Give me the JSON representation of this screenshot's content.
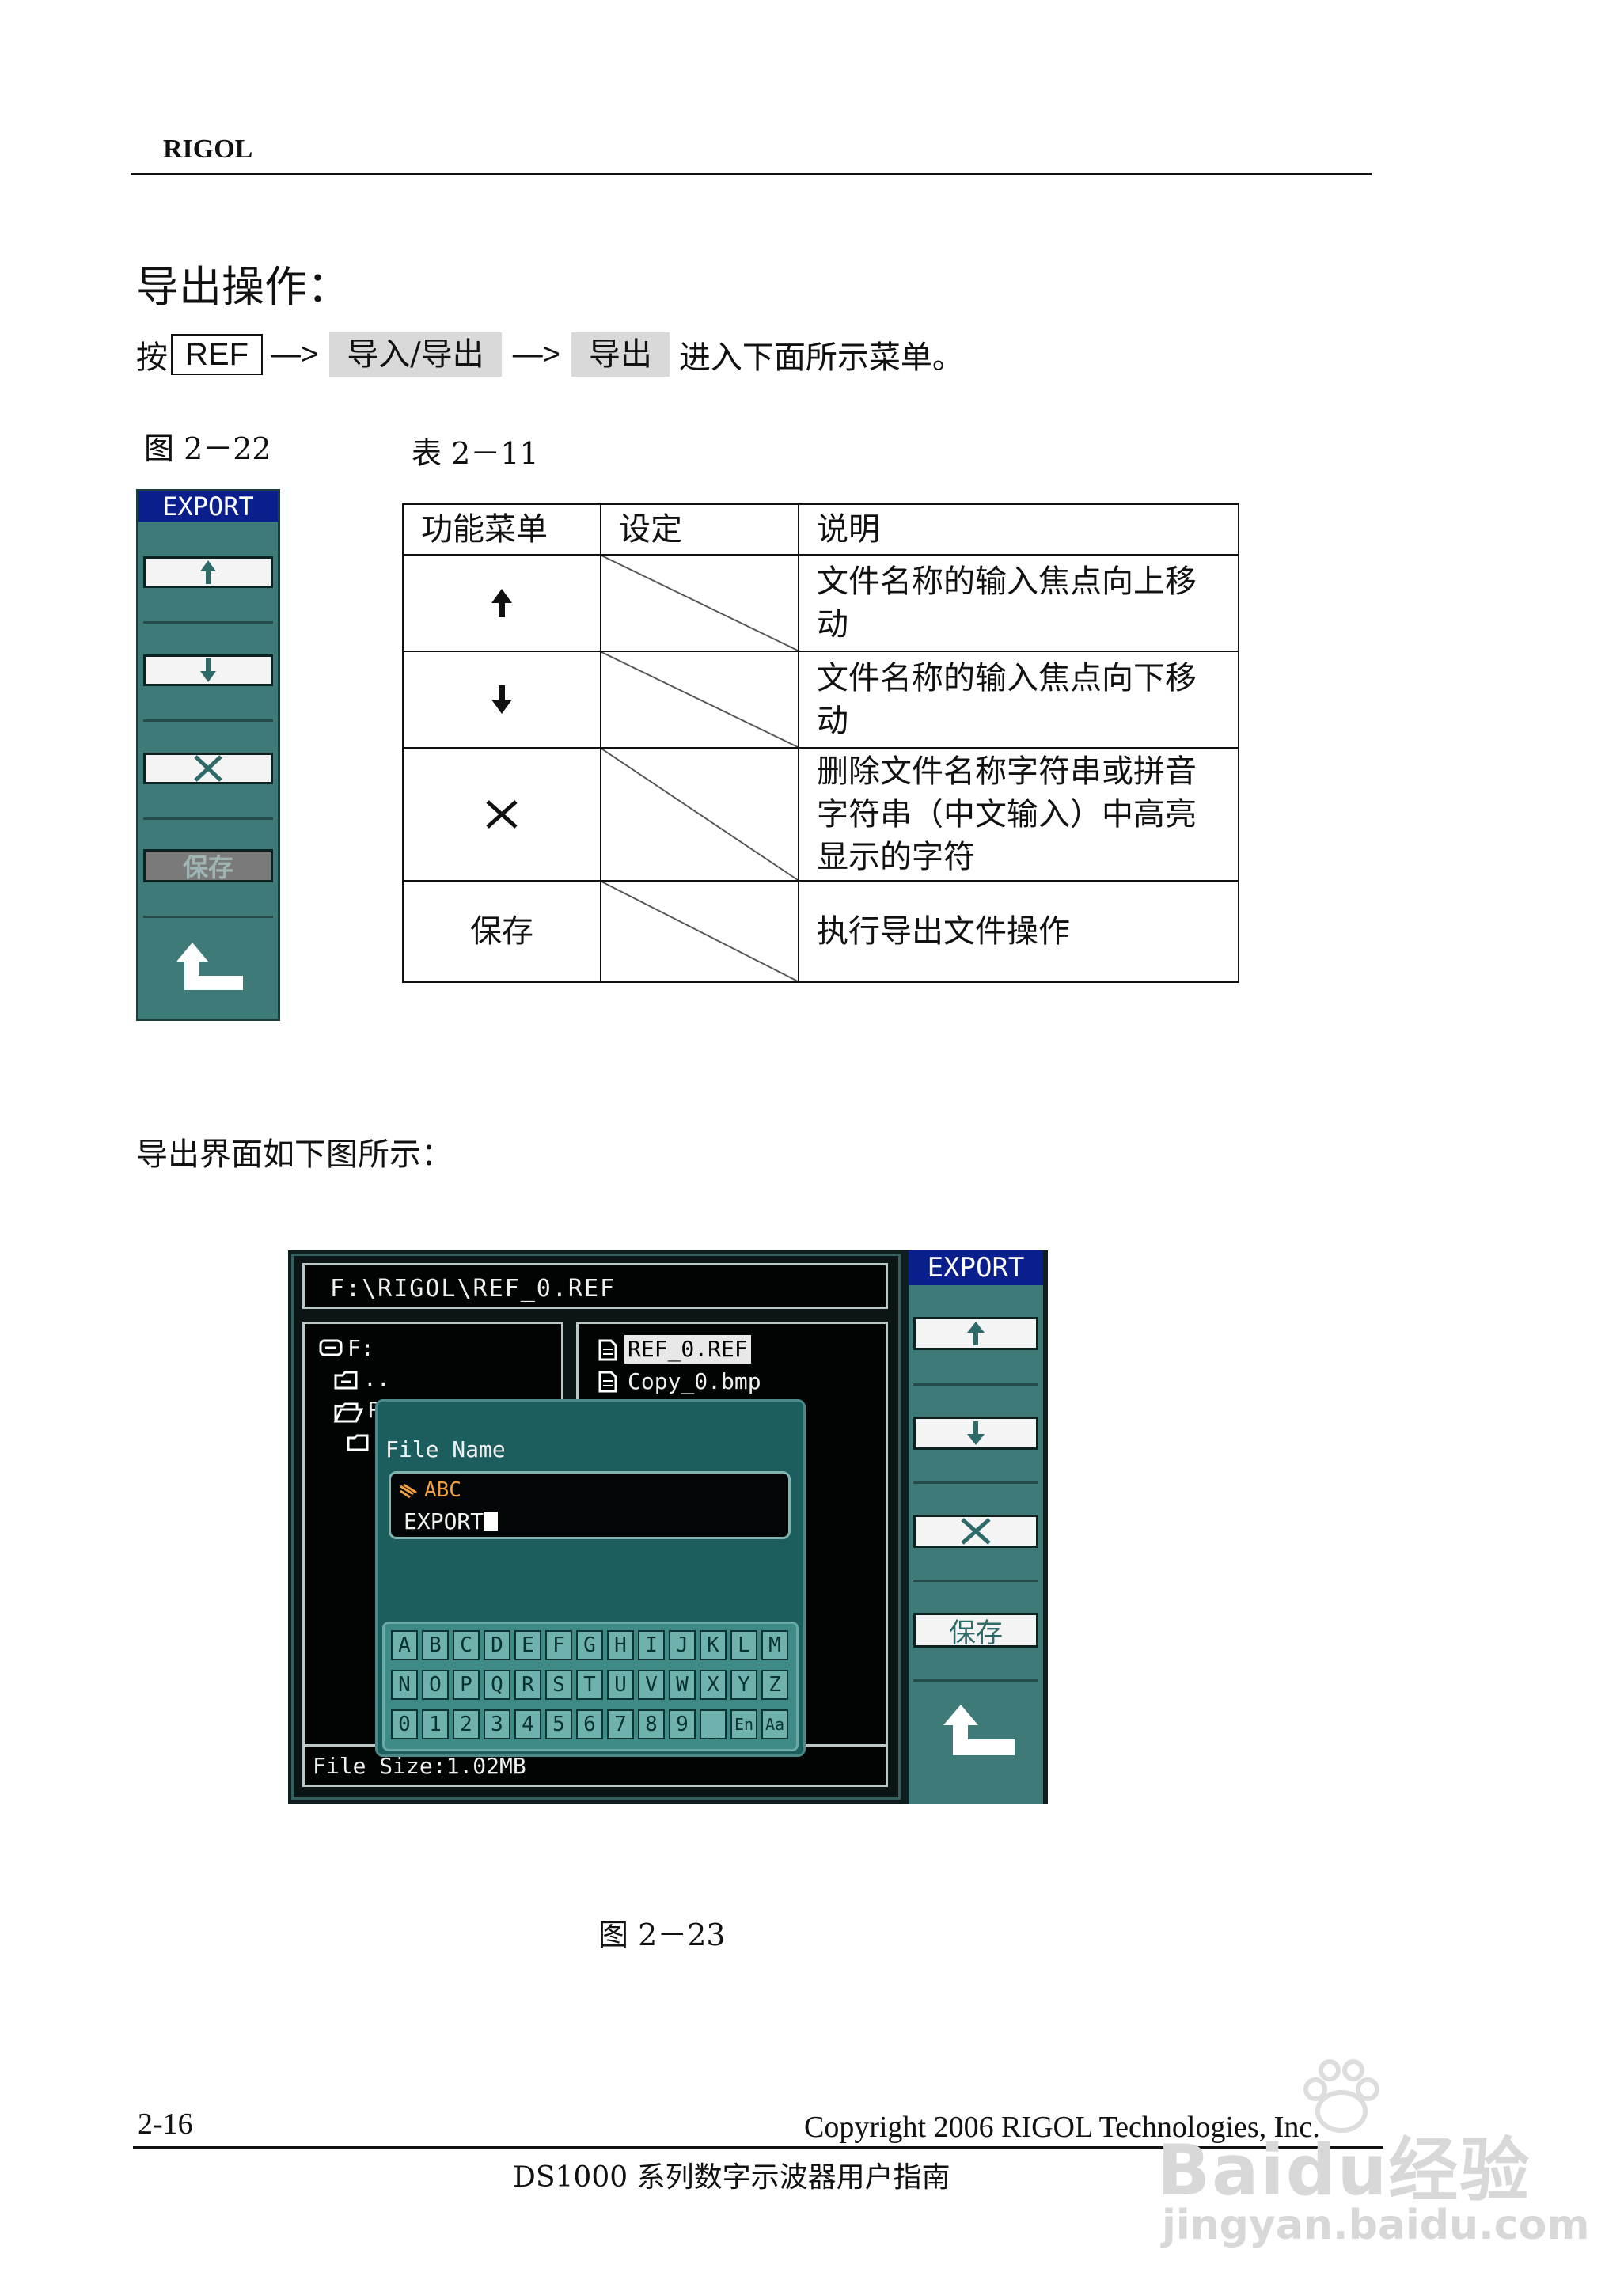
{
  "header": {
    "brand": "RIGOL"
  },
  "section": {
    "title": "导出操作：",
    "instr_prefix": "按",
    "key_ref": "REF",
    "arrow": "—>",
    "softkey_1": "导入/导出",
    "softkey_2": "导出",
    "instr_suffix": "进入下面所示菜单。"
  },
  "fig22": {
    "caption": "图 2－22",
    "menu_title": "EXPORT",
    "buttons": [
      {
        "icon": "up-arrow-icon"
      },
      {
        "icon": "down-arrow-icon"
      },
      {
        "icon": "delete-x-icon"
      },
      {
        "label": "保存",
        "state": "disabled"
      },
      {
        "icon": "return-arrow-icon"
      }
    ]
  },
  "table": {
    "caption": "表 2－11",
    "headers": [
      "功能菜单",
      "设定",
      "说明"
    ],
    "rows": [
      {
        "menu_icon": "up-arrow-icon",
        "setting": "",
        "desc": "文件名称的输入焦点向上移动"
      },
      {
        "menu_icon": "down-arrow-icon",
        "setting": "",
        "desc": "文件名称的输入焦点向下移动"
      },
      {
        "menu_icon": "delete-x-icon",
        "setting": "",
        "desc": "删除文件名称字符串或拼音字符串（中文输入）中高亮显示的字符"
      },
      {
        "menu_label": "保存",
        "setting": "",
        "desc": "执行导出文件操作"
      }
    ]
  },
  "export_text": "导出界面如下图所示：",
  "fig23": {
    "path": "F:\\RIGOL\\REF_0.REF",
    "tree": {
      "drive": "F:",
      "parent": "..",
      "folder": "R"
    },
    "files": [
      "REF_0.REF",
      "Copy_0.bmp"
    ],
    "selected_file": "REF_0.REF",
    "dialog": {
      "label": "File Name",
      "input_mode": "ABC",
      "value": "EXPORT"
    },
    "keyboard_rows": [
      [
        "A",
        "B",
        "C",
        "D",
        "E",
        "F",
        "G",
        "H",
        "I",
        "J",
        "K",
        "L",
        "M"
      ],
      [
        "N",
        "O",
        "P",
        "Q",
        "R",
        "S",
        "T",
        "U",
        "V",
        "W",
        "X",
        "Y",
        "Z"
      ],
      [
        "0",
        "1",
        "2",
        "3",
        "4",
        "5",
        "6",
        "7",
        "8",
        "9",
        "_",
        "En",
        "Aa"
      ]
    ],
    "file_size": "File Size:1.02MB",
    "menu_title": "EXPORT",
    "save_label": "保存",
    "caption": "图 2－23"
  },
  "footer": {
    "page": "2-16",
    "copyright": "Copyright 2006 RIGOL Technologies, Inc.",
    "subtitle": "DS1000 系列数字示波器用户指南"
  },
  "watermark": {
    "brand": "Baidu经验",
    "url": "jingyan.baidu.com"
  }
}
